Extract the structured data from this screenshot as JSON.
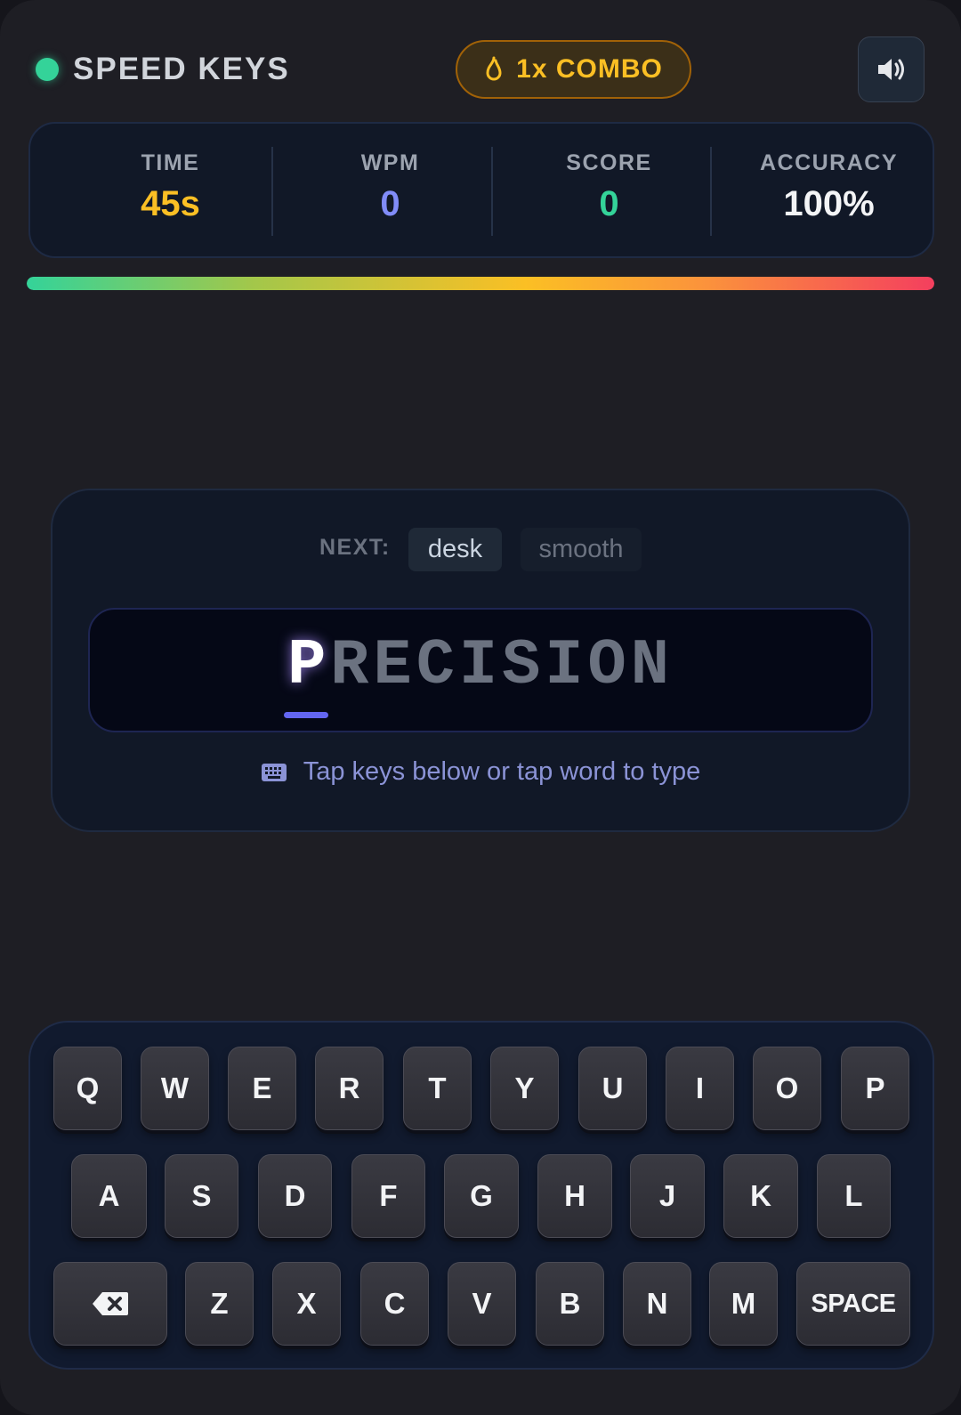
{
  "header": {
    "title": "SPEED KEYS",
    "combo_label": "1x COMBO",
    "status_color": "#34d399",
    "flame_icon": "flame-icon",
    "sound_icon": "speaker-icon"
  },
  "stats": [
    {
      "label": "TIME",
      "value": "45s",
      "color": "#fbbf24"
    },
    {
      "label": "WPM",
      "value": "0",
      "color": "#818cf8"
    },
    {
      "label": "SCORE",
      "value": "0",
      "color": "#34d399"
    },
    {
      "label": "ACCURACY",
      "value": "100%",
      "color": "#f3f4f6"
    }
  ],
  "timer_progress": 1.0,
  "word_card": {
    "next_label": "NEXT:",
    "next_words": [
      "desk",
      "smooth"
    ],
    "current_word": {
      "typed": "P",
      "remaining": "RECISION"
    },
    "hint": "Tap keys below or tap word to type",
    "hint_icon": "keyboard-icon"
  },
  "keyboard": {
    "row1": [
      "Q",
      "W",
      "E",
      "R",
      "T",
      "Y",
      "U",
      "I",
      "O",
      "P"
    ],
    "row2": [
      "A",
      "S",
      "D",
      "F",
      "G",
      "H",
      "J",
      "K",
      "L"
    ],
    "row3": [
      "Z",
      "X",
      "C",
      "V",
      "B",
      "N",
      "M"
    ],
    "backspace_icon": "backspace-icon",
    "space_label": "SPACE"
  }
}
